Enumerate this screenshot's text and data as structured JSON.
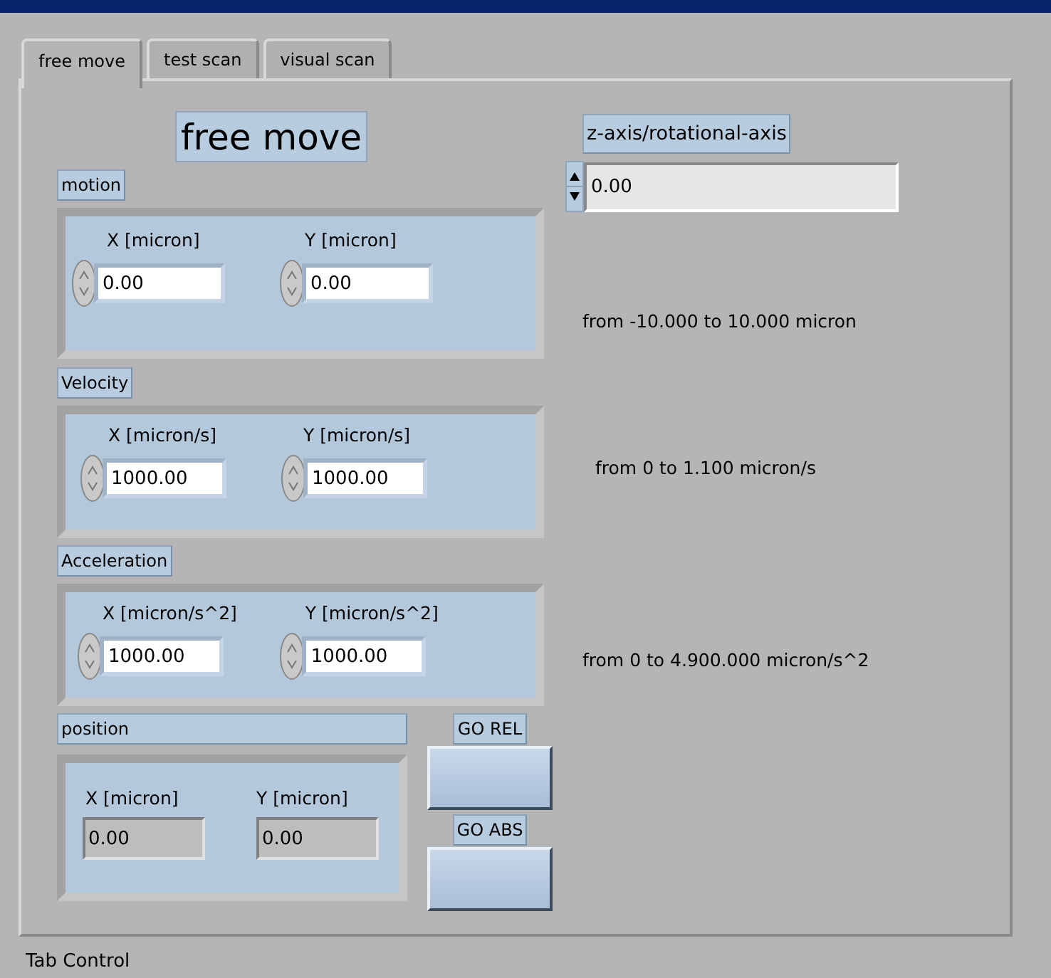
{
  "tabs": [
    {
      "label": "free move",
      "selected": true
    },
    {
      "label": "test scan",
      "selected": false
    },
    {
      "label": "visual scan",
      "selected": false
    }
  ],
  "page_title": "free move",
  "z_axis": {
    "label": "z-axis/rotational-axis",
    "value": "0.00"
  },
  "groups": [
    {
      "label": "motion",
      "fields": [
        {
          "label": "X [micron]",
          "value": "0.00"
        },
        {
          "label": "Y [micron]",
          "value": "0.00"
        }
      ],
      "note": "from -10.000 to 10.000 micron"
    },
    {
      "label": "Velocity",
      "fields": [
        {
          "label": "X [micron/s]",
          "value": "1000.00"
        },
        {
          "label": "Y [micron/s]",
          "value": "1000.00"
        }
      ],
      "note": "from 0 to 1.100 micron/s"
    },
    {
      "label": "Acceleration",
      "fields": [
        {
          "label": "X [micron/s^2]",
          "value": "1000.00"
        },
        {
          "label": "Y [micron/s^2]",
          "value": "1000.00"
        }
      ],
      "note": "from 0 to 4.900.000 micron/s^2"
    }
  ],
  "position": {
    "label": "position",
    "fields": [
      {
        "label": "X [micron]",
        "value": "0.00"
      },
      {
        "label": "Y [micron]",
        "value": "0.00"
      }
    ]
  },
  "buttons": [
    {
      "label": "GO REL"
    },
    {
      "label": "GO ABS"
    }
  ],
  "caption": "Tab Control"
}
